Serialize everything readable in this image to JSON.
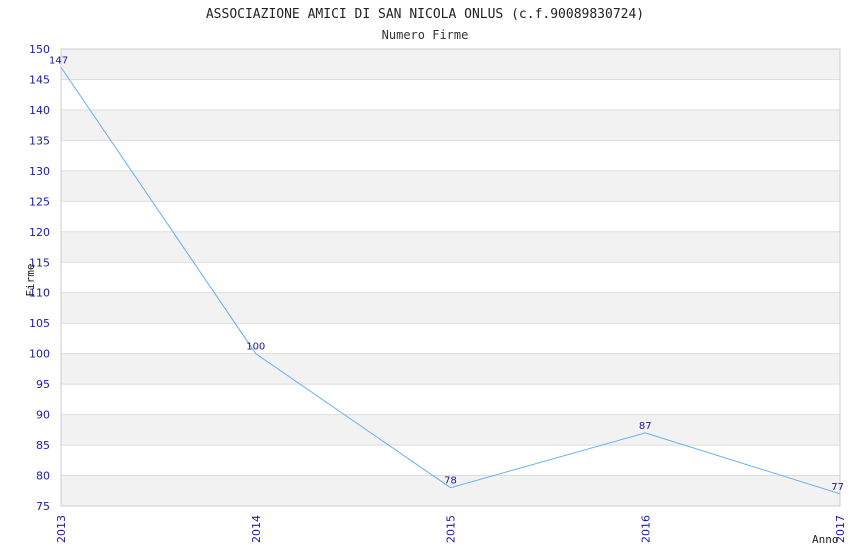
{
  "chart_data": {
    "type": "line",
    "title": "ASSOCIAZIONE AMICI DI SAN NICOLA ONLUS (c.f.90089830724)",
    "subtitle": "Numero Firme",
    "xlabel": "Anno",
    "ylabel": "Firme",
    "x": [
      "2013",
      "2014",
      "2015",
      "2016",
      "2017"
    ],
    "series": [
      {
        "values": [
          147,
          100,
          78,
          87,
          77
        ]
      }
    ],
    "ylim": [
      75,
      150
    ],
    "yticks": [
      "75",
      "80",
      "85",
      "90",
      "95",
      "100",
      "105",
      "110",
      "115",
      "120",
      "125",
      "130",
      "135",
      "140",
      "145",
      "150"
    ],
    "data_labels": [
      "147",
      "100",
      "78",
      "87",
      "77"
    ],
    "grid": true,
    "colors": {
      "line": "#6aaef0",
      "band": "#f2f2f2",
      "gridline": "#dddddd",
      "tick_text": "#1a1aa6"
    }
  }
}
